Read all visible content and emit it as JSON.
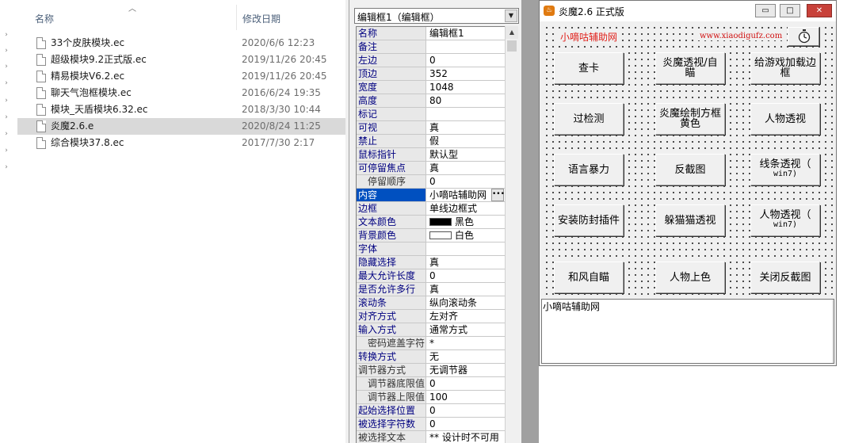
{
  "explorer": {
    "columns": {
      "name": "名称",
      "date": "修改日期"
    },
    "files": [
      {
        "name": "33个皮肤模块.ec",
        "date": "2020/6/6 12:23",
        "selected": false
      },
      {
        "name": "超级模块9.2正式版.ec",
        "date": "2019/11/26 20:45",
        "selected": false
      },
      {
        "name": "精易模块V6.2.ec",
        "date": "2019/11/26 20:45",
        "selected": false
      },
      {
        "name": "聊天气泡框模块.ec",
        "date": "2016/6/24 19:35",
        "selected": false
      },
      {
        "name": "模块_天盾模块6.32.ec",
        "date": "2018/3/30 10:44",
        "selected": false
      },
      {
        "name": "炎魔2.6.e",
        "date": "2020/8/24 11:25",
        "selected": true
      },
      {
        "name": "综合模块37.8.ec",
        "date": "2017/7/30 2:17",
        "selected": false
      }
    ]
  },
  "property_panel": {
    "selector": "编辑框1（编辑框）",
    "rows": [
      {
        "name": "名称",
        "value": "编辑框1",
        "style": "normal"
      },
      {
        "name": "备注",
        "value": "",
        "style": "normal"
      },
      {
        "name": "左边",
        "value": "0",
        "style": "normal"
      },
      {
        "name": "顶边",
        "value": "352",
        "style": "normal"
      },
      {
        "name": "宽度",
        "value": "1048",
        "style": "normal"
      },
      {
        "name": "高度",
        "value": "80",
        "style": "normal"
      },
      {
        "name": "标记",
        "value": "",
        "style": "normal"
      },
      {
        "name": "可视",
        "value": "真",
        "style": "normal"
      },
      {
        "name": "禁止",
        "value": "假",
        "style": "normal"
      },
      {
        "name": "鼠标指针",
        "value": "默认型",
        "style": "normal"
      },
      {
        "name": "可停留焦点",
        "value": "真",
        "style": "normal"
      },
      {
        "name": "停留顺序",
        "value": "0",
        "style": "sub"
      },
      {
        "name": "内容",
        "value": "小嘀咕辅助网",
        "style": "active"
      },
      {
        "name": "边框",
        "value": "单线边框式",
        "style": "normal"
      },
      {
        "name": "文本颜色",
        "value": "黑色",
        "style": "normal",
        "swatch": "#000000"
      },
      {
        "name": "背景颜色",
        "value": "白色",
        "style": "normal",
        "swatch": "#ffffff"
      },
      {
        "name": "字体",
        "value": "",
        "style": "normal"
      },
      {
        "name": "隐藏选择",
        "value": "真",
        "style": "normal"
      },
      {
        "name": "最大允许长度",
        "value": "0",
        "style": "normal"
      },
      {
        "name": "是否允许多行",
        "value": "真",
        "style": "normal"
      },
      {
        "name": "滚动条",
        "value": "纵向滚动条",
        "style": "normal"
      },
      {
        "name": "对齐方式",
        "value": "左对齐",
        "style": "normal"
      },
      {
        "name": "输入方式",
        "value": "通常方式",
        "style": "normal"
      },
      {
        "name": "密码遮盖字符",
        "value": "*",
        "style": "sub"
      },
      {
        "name": "转换方式",
        "value": "无",
        "style": "normal"
      },
      {
        "name": "调节器方式",
        "value": "无调节器",
        "style": "plain"
      },
      {
        "name": "调节器底限值",
        "value": "0",
        "style": "sub"
      },
      {
        "name": "调节器上限值",
        "value": "100",
        "style": "sub"
      },
      {
        "name": "起始选择位置",
        "value": "0",
        "style": "normal"
      },
      {
        "name": "被选择字符数",
        "value": "0",
        "style": "normal"
      },
      {
        "name": "被选择文本",
        "value": "** 设计时不可用",
        "style": "plain"
      }
    ]
  },
  "designer": {
    "title": "炎魔2.6 正式版",
    "window_buttons": {
      "minimize": "▭",
      "maximize": "□",
      "close": "✕"
    },
    "brand_label": "小嘀咕辅助网",
    "brand_url": "www.xiaodigufz.com",
    "buttons": [
      {
        "label": "查卡",
        "small": ""
      },
      {
        "label": "炎魔透视/自瞄",
        "small": ""
      },
      {
        "label": "给游戏加载边框",
        "small": ""
      },
      {
        "label": "过检测",
        "small": ""
      },
      {
        "label": "炎魔绘制方框黄色",
        "small": ""
      },
      {
        "label": "人物透视",
        "small": ""
      },
      {
        "label": "语言暴力",
        "small": ""
      },
      {
        "label": "反截图",
        "small": ""
      },
      {
        "label": "线条透视（",
        "small": "win7)"
      },
      {
        "label": "安装防封插件",
        "small": ""
      },
      {
        "label": "躲猫猫透视",
        "small": ""
      },
      {
        "label": "人物透视（",
        "small": "win7)"
      },
      {
        "label": "和风自瞄",
        "small": ""
      },
      {
        "label": "人物上色",
        "small": ""
      },
      {
        "label": "关闭反截图",
        "small": ""
      }
    ],
    "memo_text": "小嘀咕辅助网"
  }
}
